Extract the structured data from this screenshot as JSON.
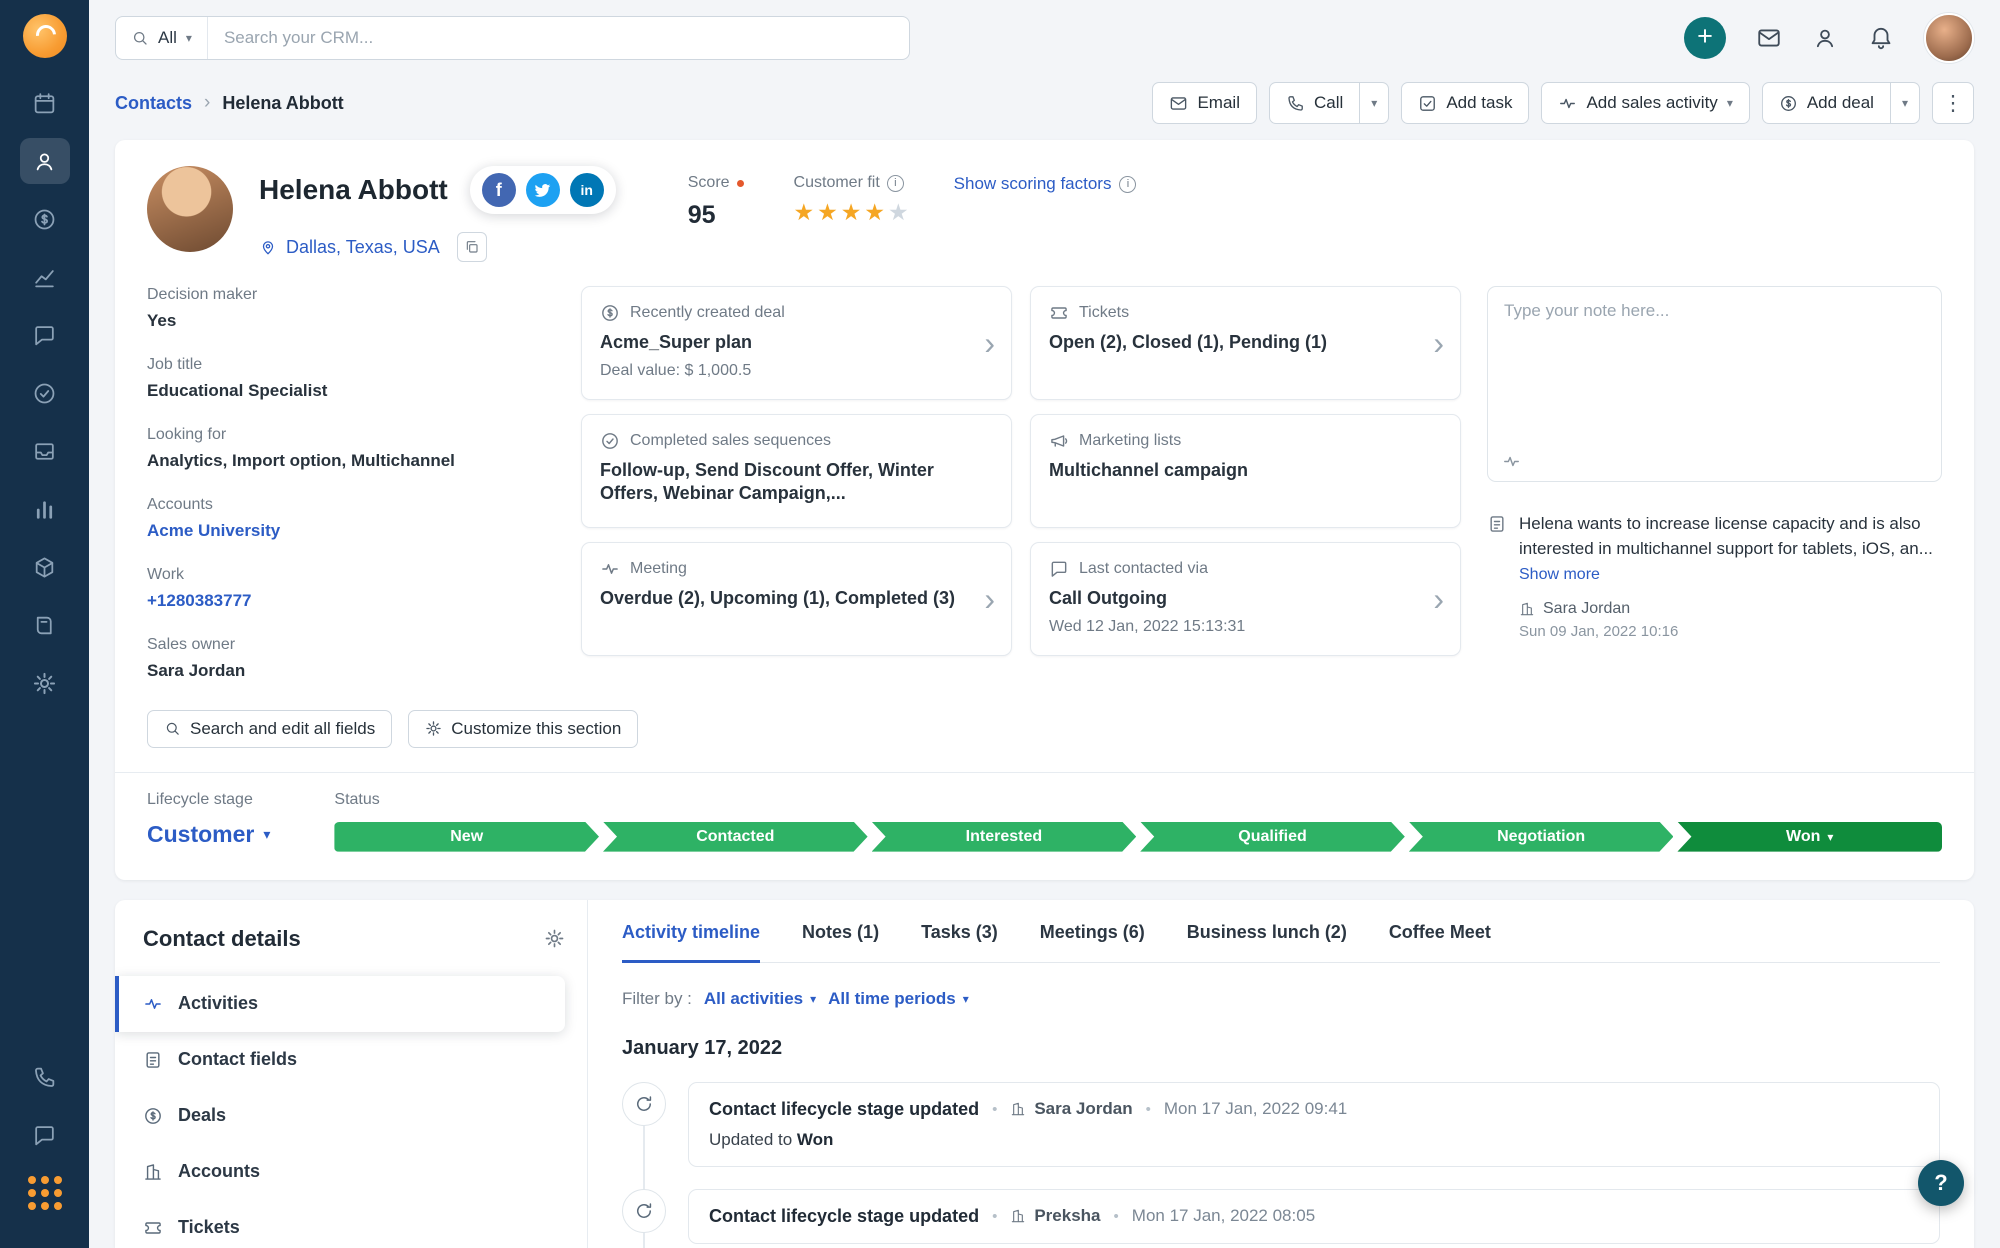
{
  "colors": {
    "accent_blue": "#2c5cc5",
    "sidebar_navy": "#15304a",
    "brand_orange": "#f89c32",
    "stage_green": "#2eb265",
    "stage_won_green": "#0f8c3c",
    "star_orange": "#f5a623",
    "plus_teal": "#0d7377"
  },
  "icons": [
    "search-icon",
    "calendar-icon",
    "contacts-icon",
    "deals-icon",
    "analytics-icon",
    "chat-icon",
    "target-icon",
    "inbox-icon",
    "reports-icon",
    "products-icon",
    "documents-icon",
    "settings-icon",
    "phone-icon",
    "apps-grid-icon",
    "plus-icon",
    "envelope-icon",
    "person-icon",
    "bell-icon",
    "pin-icon",
    "copy-icon",
    "ticket-icon",
    "megaphone-icon",
    "pulse-icon",
    "note-icon",
    "building-icon",
    "gear-icon",
    "refresh-icon",
    "chevron-icons"
  ],
  "topbar": {
    "search_scope": "All",
    "search_placeholder": "Search your CRM..."
  },
  "breadcrumb": {
    "section": "Contacts",
    "current": "Helena Abbott"
  },
  "actions": {
    "email": "Email",
    "call": "Call",
    "add_task": "Add task",
    "add_sales_activity": "Add sales activity",
    "add_deal": "Add deal"
  },
  "contact": {
    "name": "Helena Abbott",
    "location": "Dallas, Texas, USA",
    "score_label": "Score",
    "score": "95",
    "customer_fit_label": "Customer fit",
    "stars_filled": 4,
    "stars_total": 5,
    "scoring_link": "Show scoring factors"
  },
  "fields": [
    {
      "label": "Decision maker",
      "value": "Yes"
    },
    {
      "label": "Job title",
      "value": "Educational Specialist"
    },
    {
      "label": "Looking for",
      "value": "Analytics, Import option, Multichannel"
    },
    {
      "label": "Accounts",
      "value": "Acme University"
    },
    {
      "label": "Work",
      "value": "+1280383777"
    },
    {
      "label": "Sales owner",
      "value": "Sara Jordan"
    }
  ],
  "highlight_cards": [
    {
      "title": "Recently created deal",
      "line1": "Acme_Super plan",
      "line2": "Deal value: $ 1,000.5"
    },
    {
      "title": "Tickets",
      "line1": "Open (2), Closed (1), Pending (1)"
    },
    {
      "title": "Completed sales sequences",
      "line1": "Follow-up, Send Discount Offer, Winter Offers, Webinar Campaign,..."
    },
    {
      "title": "Marketing lists",
      "line1": "Multichannel campaign"
    },
    {
      "title": "Meeting",
      "line1": "Overdue (2), Upcoming (1), Completed (3)"
    },
    {
      "title": "Last contacted via",
      "line1": "Call Outgoing",
      "line2": "Wed 12 Jan, 2022 15:13:31"
    }
  ],
  "note": {
    "placeholder": "Type your note here...",
    "text": "Helena wants to increase license capacity and is also interested in multichannel support for tablets, iOS, an...",
    "show_more": "Show more",
    "author": "Sara Jordan",
    "time": "Sun 09 Jan, 2022 10:16"
  },
  "section_actions": {
    "search_fields": "Search and edit all fields",
    "customize": "Customize this section"
  },
  "lifecycle": {
    "label": "Lifecycle stage",
    "value": "Customer",
    "status_label": "Status",
    "stages": [
      "New",
      "Contacted",
      "Interested",
      "Qualified",
      "Negotiation",
      "Won"
    ]
  },
  "contact_details": {
    "title": "Contact details",
    "items": [
      "Activities",
      "Contact fields",
      "Deals",
      "Accounts",
      "Tickets"
    ]
  },
  "tabs": [
    "Activity timeline",
    "Notes (1)",
    "Tasks (3)",
    "Meetings (6)",
    "Business lunch (2)",
    "Coffee Meet"
  ],
  "filter": {
    "label": "Filter by :",
    "activities": "All activities",
    "periods": "All time periods"
  },
  "timeline": {
    "date": "January 17, 2022",
    "entries": [
      {
        "title": "Contact lifecycle stage updated",
        "author": "Sara Jordan",
        "time": "Mon 17 Jan, 2022 09:41",
        "detail_label": "Updated to",
        "detail_value": "Won"
      },
      {
        "title": "Contact lifecycle stage updated",
        "author": "Preksha",
        "time": "Mon 17 Jan, 2022 08:05"
      }
    ]
  },
  "help_label": "?"
}
